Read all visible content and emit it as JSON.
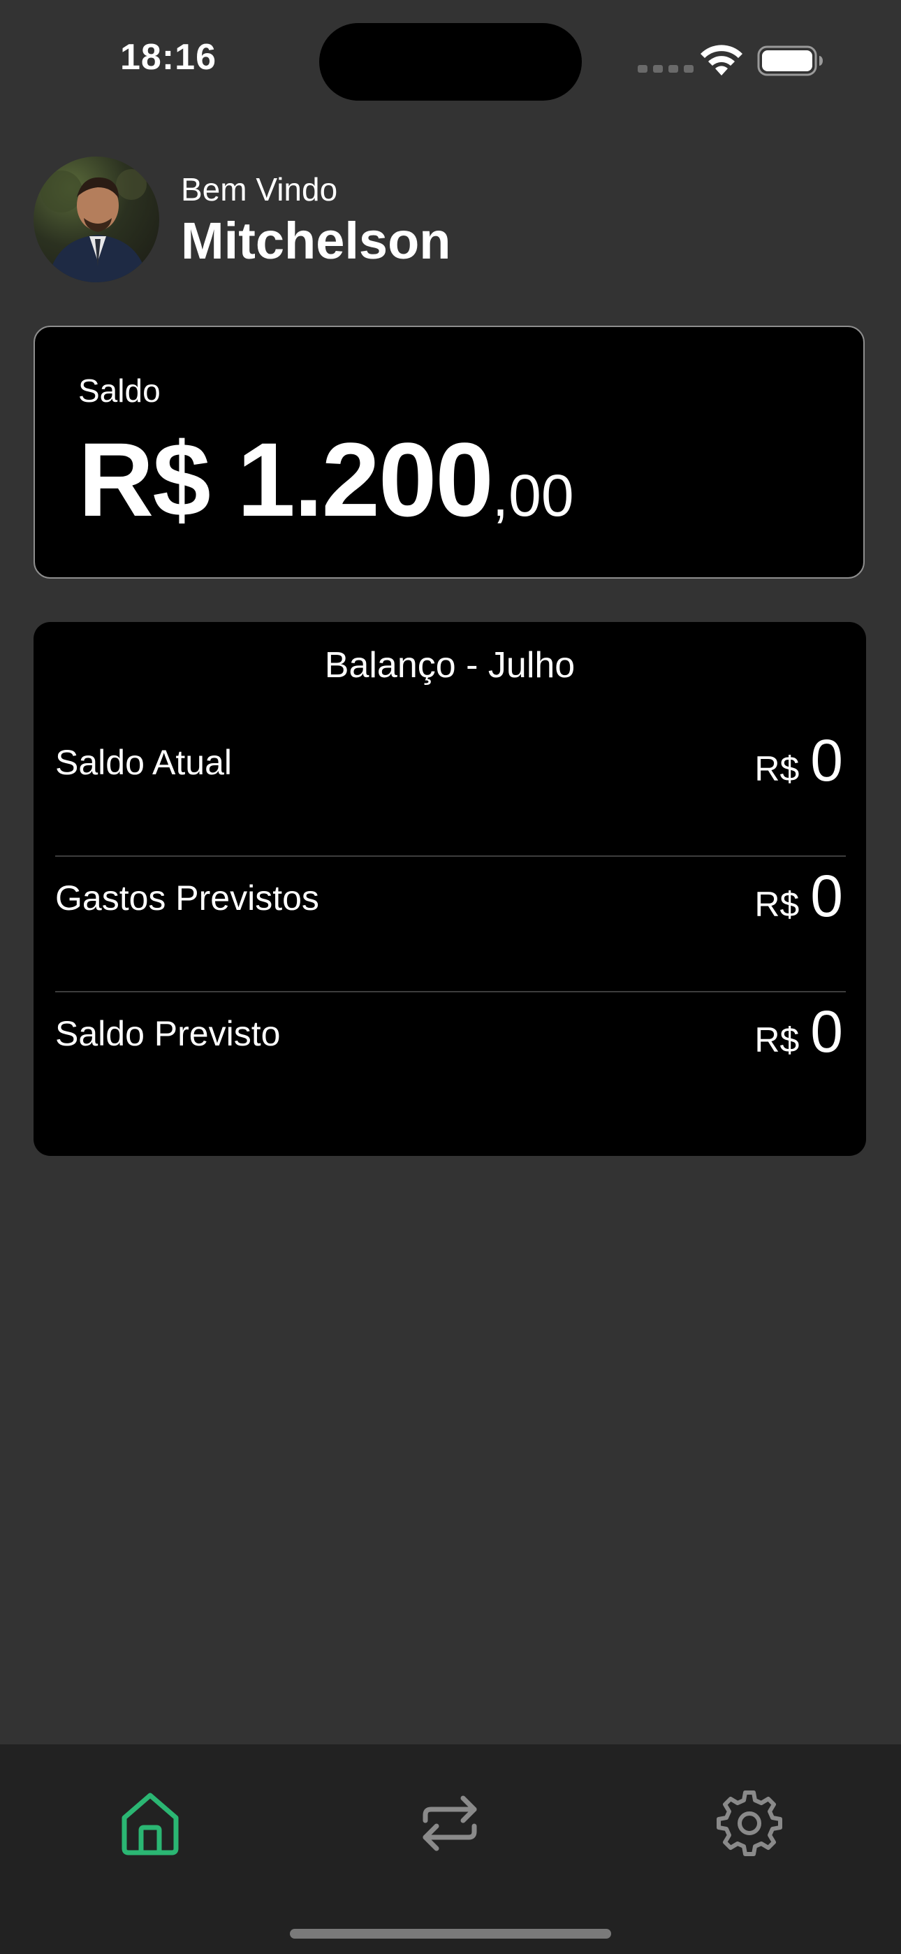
{
  "status_bar": {
    "time": "18:16"
  },
  "header": {
    "greeting": "Bem Vindo",
    "user_name": "Mitchelson"
  },
  "balance_card": {
    "label": "Saldo",
    "amount_main": "R$ 1.200",
    "amount_cents": ",00"
  },
  "summary": {
    "title": "Balanço - Julho",
    "rows": [
      {
        "label": "Saldo Atual",
        "currency": "R$",
        "value": "0"
      },
      {
        "label": "Gastos Previstos",
        "currency": "R$",
        "value": "0"
      },
      {
        "label": "Saldo Previsto",
        "currency": "R$",
        "value": "0"
      }
    ]
  },
  "tab_bar": {
    "items": [
      {
        "icon": "home-icon",
        "active": true
      },
      {
        "icon": "transactions-icon",
        "active": false
      },
      {
        "icon": "gear-icon",
        "active": false
      }
    ],
    "active_color": "#2bb673",
    "inactive_color": "#8a8a8a"
  },
  "colors": {
    "background": "#333333",
    "card": "#000000",
    "accent": "#2bb673"
  }
}
